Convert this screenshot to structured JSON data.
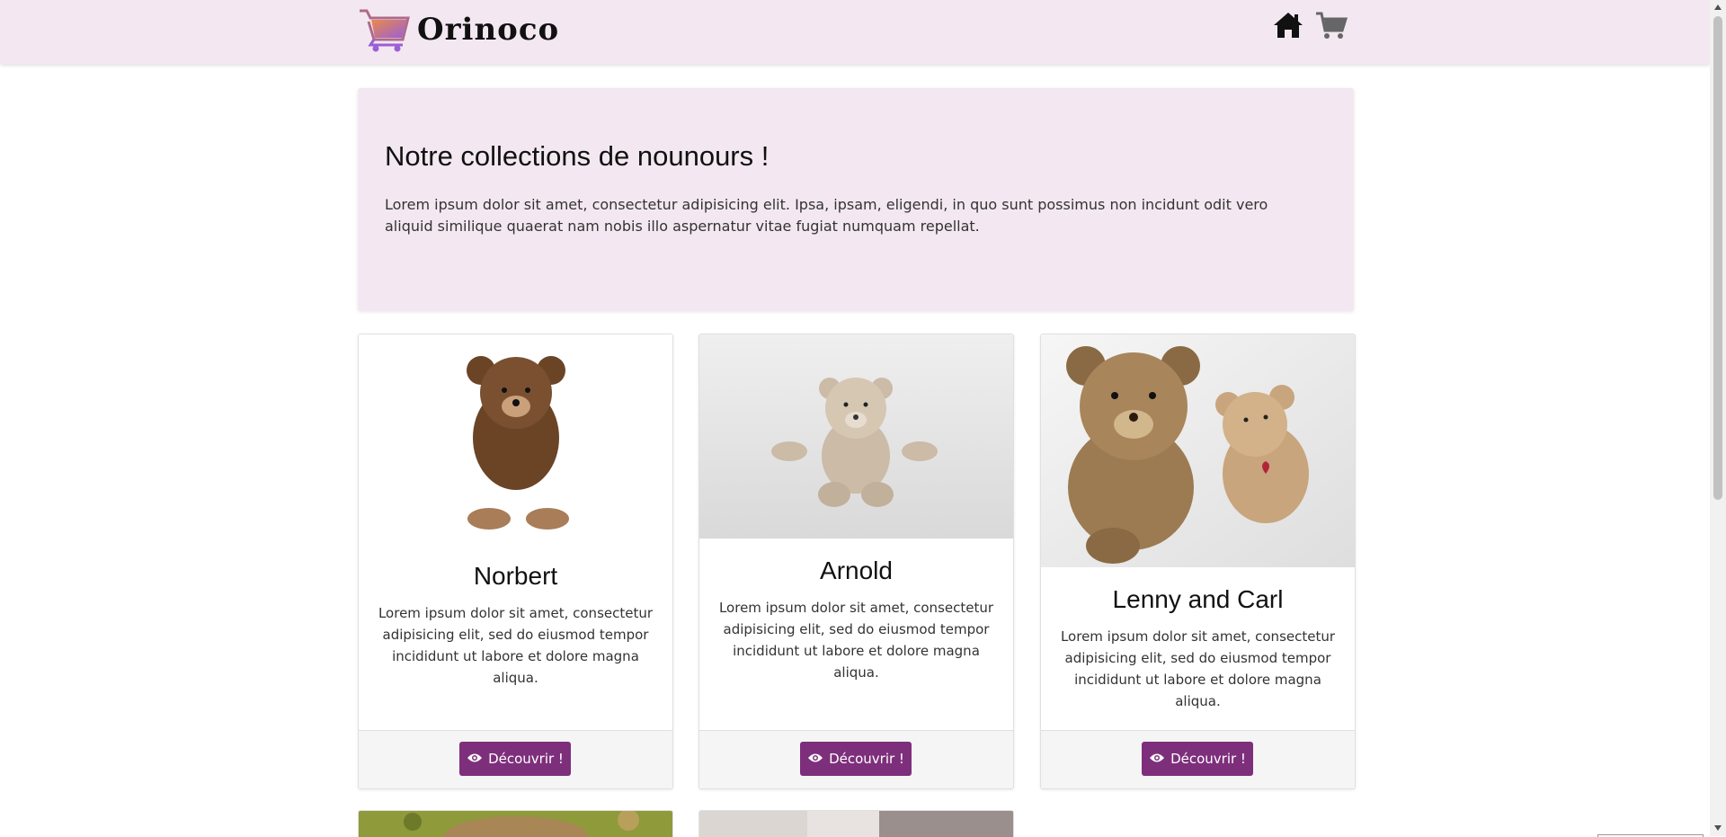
{
  "header": {
    "brand": "Orinoco",
    "icons": [
      "cart-logo-icon",
      "home-icon",
      "cart-icon"
    ]
  },
  "hero": {
    "title": "Notre collections de nounours !",
    "text": "Lorem ipsum dolor sit amet, consectetur adipisicing elit. Ipsa, ipsam, eligendi, in quo sunt possimus non incidunt odit vero aliquid similique quaerat nam nobis illo aspernatur vitae fugiat numquam repellat."
  },
  "products": [
    {
      "name": "Norbert",
      "description": "Lorem ipsum dolor sit amet, consectetur adipisicing elit, sed do eiusmod tempor incididunt ut labore et dolore magna aliqua.",
      "button": "Découvrir !"
    },
    {
      "name": "Arnold",
      "description": "Lorem ipsum dolor sit amet, consectetur adipisicing elit, sed do eiusmod tempor incididunt ut labore et dolore magna aliqua.",
      "button": "Découvrir !"
    },
    {
      "name": "Lenny and Carl",
      "description": "Lorem ipsum dolor sit amet, consectetur adipisicing elit, sed do eiusmod tempor incididunt ut labore et dolore magna aliqua.",
      "button": "Découvrir !"
    }
  ],
  "colors": {
    "header_bg": "#f3e8f1",
    "button": "#7d2f7b",
    "logo_gradient_start": "#e98a4a",
    "logo_gradient_end": "#9b5fd6"
  }
}
